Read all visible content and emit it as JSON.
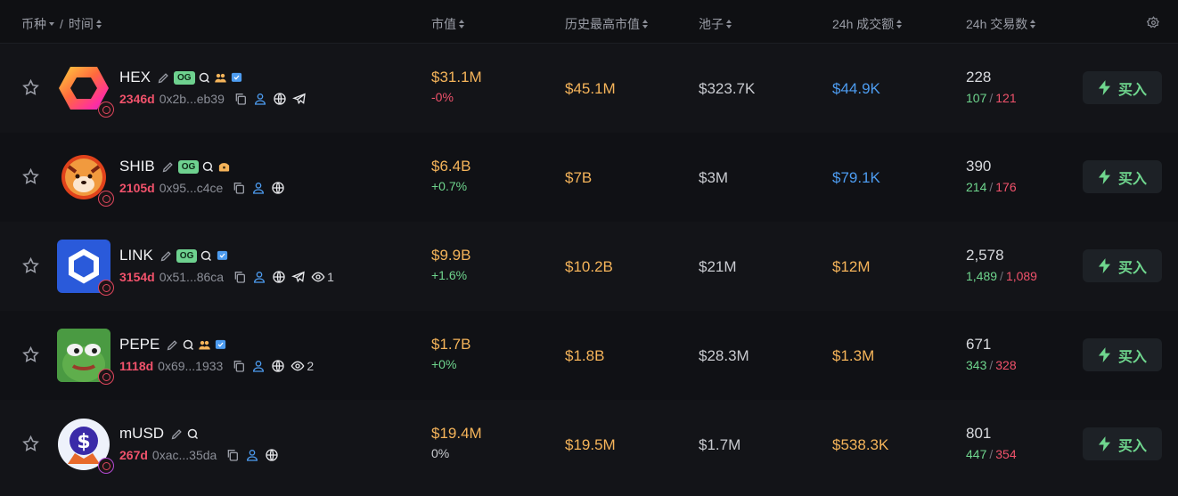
{
  "header": {
    "token_time": "币种",
    "separator": "/",
    "time": "时间",
    "market_cap": "市值",
    "ath_market_cap": "历史最高市值",
    "pool": "池子",
    "volume_24h": "24h 成交额",
    "txs_24h": "24h 交易数"
  },
  "buy_label": "买入",
  "og_label": "OG",
  "rows": [
    {
      "name": "HEX",
      "age": "2346d",
      "address": "0x2b...eb39",
      "market_cap": "$31.1M",
      "change": "-0%",
      "ath": "$45.1M",
      "pool": "$323.7K",
      "volume": "$44.9K",
      "txs": "228",
      "buys": "107",
      "sells": "121"
    },
    {
      "name": "SHIB",
      "age": "2105d",
      "address": "0x95...c4ce",
      "market_cap": "$6.4B",
      "change": "+0.7%",
      "ath": "$7B",
      "pool": "$3M",
      "volume": "$79.1K",
      "txs": "390",
      "buys": "214",
      "sells": "176"
    },
    {
      "name": "LINK",
      "age": "3154d",
      "address": "0x51...86ca",
      "watchers": "1",
      "market_cap": "$9.9B",
      "change": "+1.6%",
      "ath": "$10.2B",
      "pool": "$21M",
      "volume": "$12M",
      "txs": "2,578",
      "buys": "1,489",
      "sells": "1,089"
    },
    {
      "name": "PEPE",
      "age": "1118d",
      "address": "0x69...1933",
      "watchers": "2",
      "market_cap": "$1.7B",
      "change": "+0%",
      "ath": "$1.8B",
      "pool": "$28.3M",
      "volume": "$1.3M",
      "txs": "671",
      "buys": "343",
      "sells": "328"
    },
    {
      "name": "mUSD",
      "age": "267d",
      "address": "0xac...35da",
      "market_cap": "$19.4M",
      "change": "0%",
      "ath": "$19.5M",
      "pool": "$1.7M",
      "volume": "$538.3K",
      "txs": "801",
      "buys": "447",
      "sells": "354"
    }
  ],
  "colors": {
    "positive": "#6fd68e",
    "negative": "#f0526b",
    "market_cap": "#f5b45a",
    "volume_blue": "#4d9cf0",
    "og_badge": "#6ed18f"
  }
}
